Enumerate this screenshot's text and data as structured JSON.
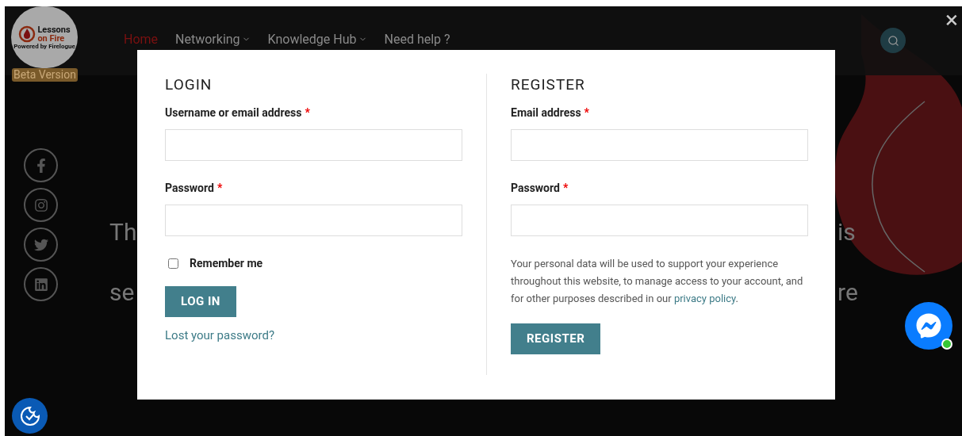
{
  "header": {
    "logo": {
      "line_1": "Lessons",
      "line_2": "on Fire",
      "tagline": "Powered by Firelogue",
      "badge": "Beta Version"
    },
    "nav": [
      {
        "label": "Home",
        "selected": true,
        "dropdown": false
      },
      {
        "label": "Networking",
        "selected": false,
        "dropdown": true
      },
      {
        "label": "Knowledge Hub",
        "selected": false,
        "dropdown": true
      },
      {
        "label": "Need help ?",
        "selected": false,
        "dropdown": false
      }
    ]
  },
  "hero": {
    "fragments_left": [
      "Th",
      "se"
    ],
    "fragments_right": [
      "is",
      "re"
    ]
  },
  "close": "×",
  "modal": {
    "login": {
      "title": "LOGIN",
      "fields": [
        {
          "label": "Username or email address",
          "required": "*"
        },
        {
          "label": "Password",
          "required": "*"
        }
      ],
      "remember": {
        "label": "Remember me",
        "checked": false
      },
      "button": "LOG IN",
      "lost_link": "Lost your password?"
    },
    "register": {
      "title": "REGISTER",
      "fields": [
        {
          "label": "Email address",
          "required": "*"
        },
        {
          "label": "Password",
          "required": "*"
        }
      ],
      "notice": "Your personal data will be used to support your experience throughout this website, to manage access to your account, and for other purposes described in our",
      "notice_link": "privacy policy",
      "notice_end": ".",
      "button": "REGISTER"
    }
  }
}
